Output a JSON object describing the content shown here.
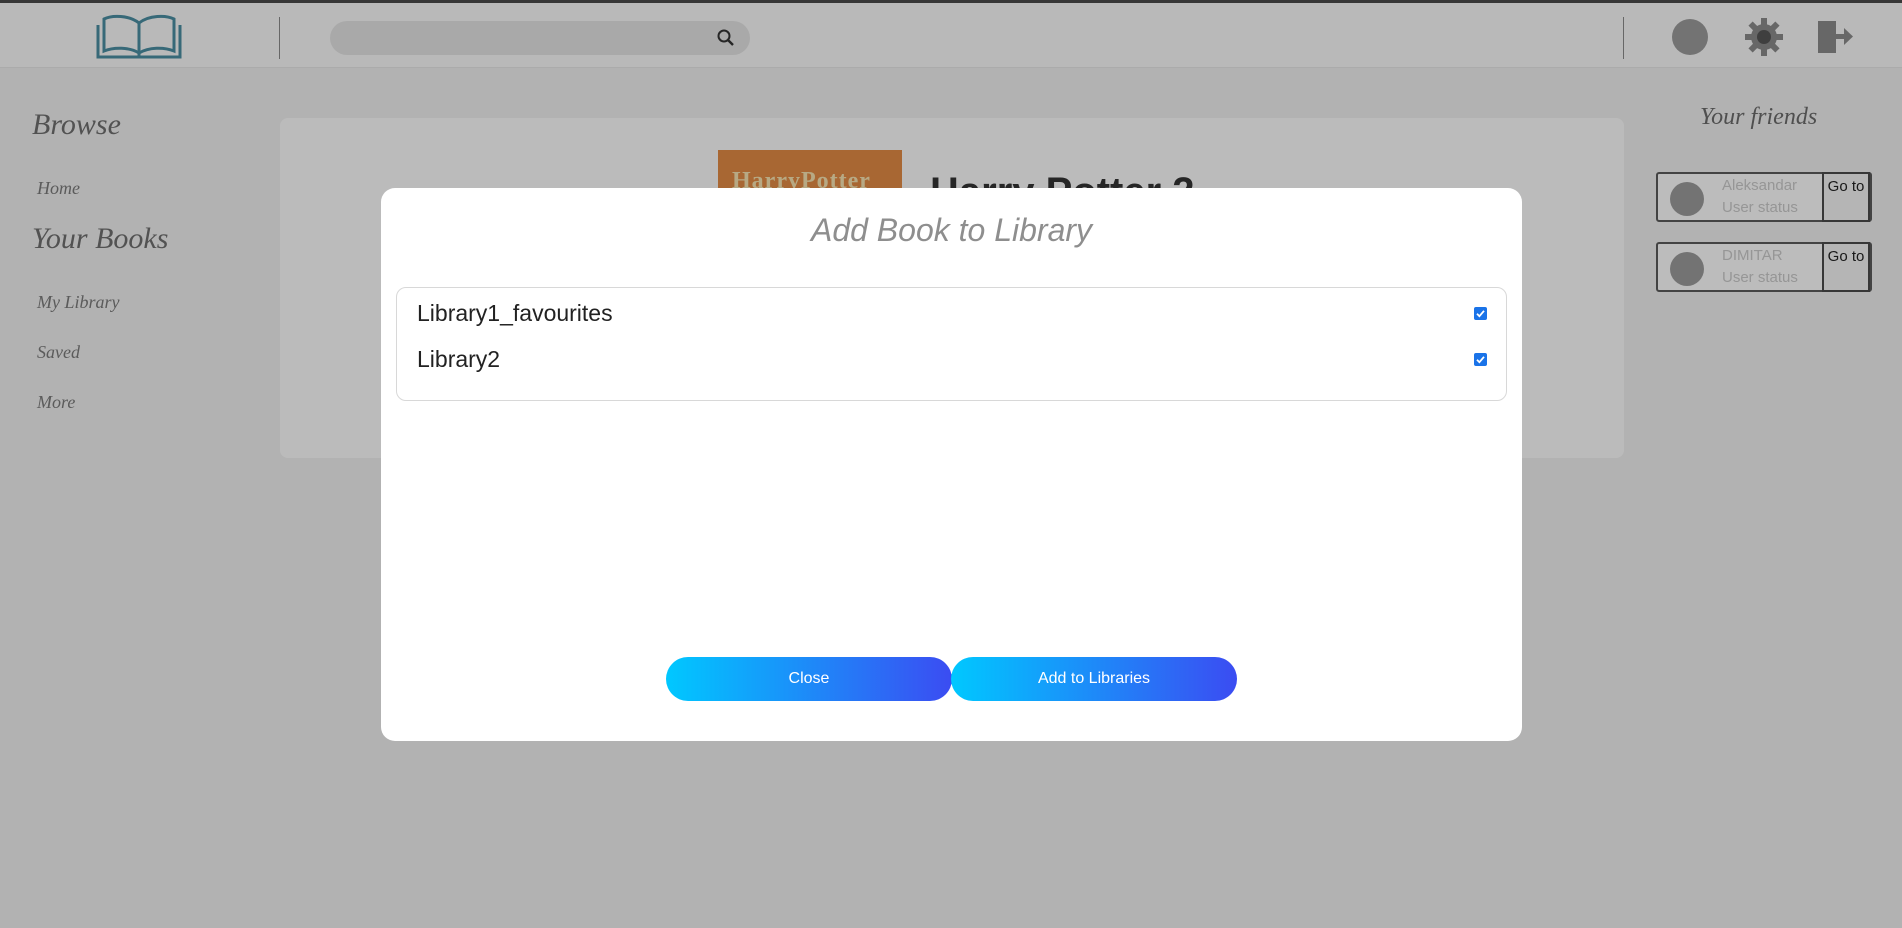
{
  "header": {
    "search": {
      "placeholder": ""
    },
    "icons": [
      "book-logo-icon",
      "search-icon",
      "user-avatar-icon",
      "gear-icon",
      "logout-icon"
    ]
  },
  "sidebar": {
    "browse_heading": "Browse",
    "browse_items": [
      {
        "label": "Home"
      }
    ],
    "books_heading": "Your Books",
    "books_items": [
      {
        "label": "My Library"
      },
      {
        "label": "Saved"
      },
      {
        "label": "More"
      }
    ]
  },
  "main": {
    "cover_text": "HarryPotter",
    "book_title": "Harry Potter 2"
  },
  "friends": {
    "heading": "Your friends",
    "items": [
      {
        "name": "Aleksandar",
        "status": "User status",
        "go_label": "Go to"
      },
      {
        "name": "DIMITAR",
        "status": "User status",
        "go_label": "Go to"
      }
    ]
  },
  "modal": {
    "title": "Add Book to Library",
    "libraries": [
      {
        "name": "Library1_favourites",
        "checked": true
      },
      {
        "name": "Library2",
        "checked": true
      }
    ],
    "close_label": "Close",
    "add_label": "Add to Libraries"
  },
  "colors": {
    "button_gradient_start": "#00c8ff",
    "button_gradient_end": "#3b4cf2",
    "checkbox": "#1a73e8",
    "logo": "#4a8ca0"
  }
}
